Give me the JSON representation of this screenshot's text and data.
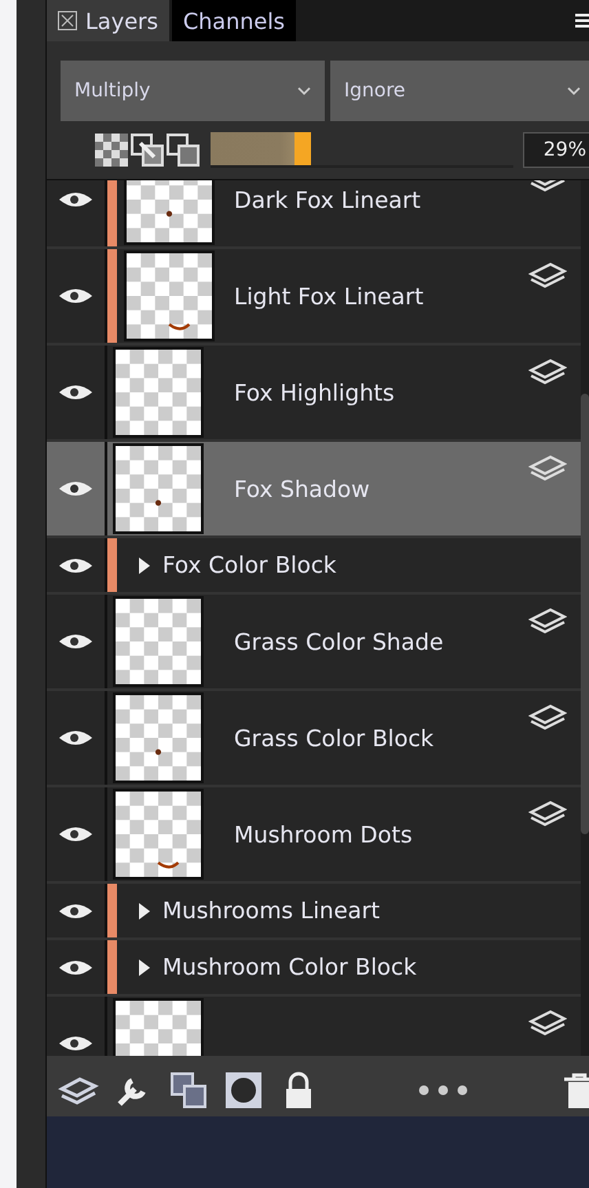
{
  "tabs": [
    {
      "label": "Layers",
      "selected": true
    },
    {
      "label": "Channels",
      "selected": false
    }
  ],
  "blend_mode": {
    "value": "Multiply"
  },
  "layer_setting": {
    "value": "Ignore"
  },
  "opacity": {
    "level": 0.33,
    "reading": "29%"
  },
  "layers": [
    {
      "kind": "layer",
      "name": "Dark Fox Lineart",
      "visible": true,
      "clipped": true,
      "selected": false
    },
    {
      "kind": "layer",
      "name": "Light Fox Lineart",
      "visible": true,
      "clipped": true,
      "selected": false
    },
    {
      "kind": "layer",
      "name": "Fox Highlights",
      "visible": true,
      "clipped": false,
      "selected": false
    },
    {
      "kind": "layer",
      "name": "Fox Shadow",
      "visible": true,
      "clipped": false,
      "selected": true
    },
    {
      "kind": "folder",
      "name": "Fox Color Block",
      "visible": true,
      "clipped": true,
      "selected": false
    },
    {
      "kind": "layer",
      "name": "Grass Color Shade",
      "visible": true,
      "clipped": false,
      "selected": false
    },
    {
      "kind": "layer",
      "name": "Grass Color Block",
      "visible": true,
      "clipped": false,
      "selected": false
    },
    {
      "kind": "layer",
      "name": "Mushroom Dots",
      "visible": true,
      "clipped": false,
      "selected": false
    },
    {
      "kind": "folder",
      "name": "Mushrooms Lineart",
      "visible": true,
      "clipped": true,
      "selected": false
    },
    {
      "kind": "folder",
      "name": "Mushroom Color Block",
      "visible": true,
      "clipped": true,
      "selected": false
    },
    {
      "kind": "layer",
      "visible": true,
      "clipped": false,
      "selected": false
    }
  ]
}
